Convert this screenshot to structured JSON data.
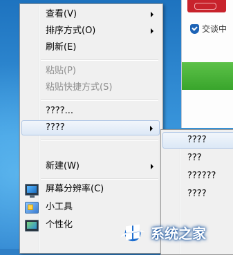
{
  "background_window": {
    "chat_label": "交谈中"
  },
  "context_menu": {
    "items": [
      {
        "label": "查看(V)",
        "submenu": true,
        "disabled": false
      },
      {
        "label": "排序方式(O)",
        "submenu": true,
        "disabled": false
      },
      {
        "label": "刷新(E)",
        "submenu": false,
        "disabled": false
      },
      {
        "label": "粘贴(P)",
        "submenu": false,
        "disabled": true
      },
      {
        "label": "粘贴快捷方式(S)",
        "submenu": false,
        "disabled": true
      },
      {
        "label": "????...",
        "submenu": false,
        "disabled": false
      },
      {
        "label": "????",
        "submenu": true,
        "disabled": false,
        "highlighted": true
      },
      {
        "label": "新建(W)",
        "submenu": true,
        "disabled": false
      },
      {
        "label": "屏幕分辨率(C)",
        "submenu": false,
        "disabled": false,
        "icon": "monitor-icon"
      },
      {
        "label": "小工具",
        "submenu": false,
        "disabled": false,
        "icon": "gadget-icon"
      },
      {
        "label": "个性化",
        "submenu": false,
        "disabled": false,
        "icon": "personalize-icon"
      }
    ]
  },
  "submenu": {
    "items": [
      {
        "label": "????",
        "highlighted": true
      },
      {
        "label": "???"
      },
      {
        "label": "??????"
      },
      {
        "label": "????"
      }
    ]
  },
  "watermark": {
    "text": "系统之家"
  },
  "colors": {
    "menu_bg": "#f0f0f0",
    "highlight_border": "#aec6e6",
    "desktop_blue": "#2f7fc6"
  }
}
